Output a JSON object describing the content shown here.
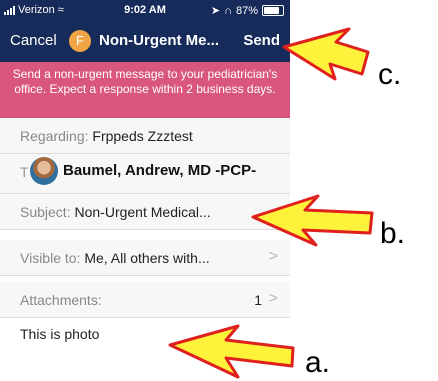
{
  "status_bar": {
    "carrier": "Verizon",
    "time": "9:02 AM",
    "battery": "87%"
  },
  "nav": {
    "cancel_label": "Cancel",
    "avatar_letter": "F",
    "title": "Non-Urgent Me...",
    "send_label": "Send"
  },
  "banner": {
    "text": "Send a non-urgent message to your pediatrician's office. Expect a response within 2 business days."
  },
  "form": {
    "regarding_label": "Regarding:",
    "regarding_value": "Frppeds Zzztest",
    "to_label": "T",
    "to_name": "Baumel, Andrew, MD -PCP-",
    "subject_label": "Subject:",
    "subject_value": "Non-Urgent Medical...",
    "visible_label": "Visible to:",
    "visible_value": "Me, All others with...",
    "attachments_label": "Attachments:",
    "attachments_count": "1",
    "chevron_glyph": ">",
    "body_text": "This is photo"
  },
  "annotations": {
    "a": "a.",
    "b": "b.",
    "c": "c."
  },
  "colors": {
    "navbar": "#162b59",
    "banner": "#d9567d",
    "avatar": "#f1a545",
    "arrow_fill": "#fff23a",
    "arrow_stroke": "#e0201c"
  }
}
